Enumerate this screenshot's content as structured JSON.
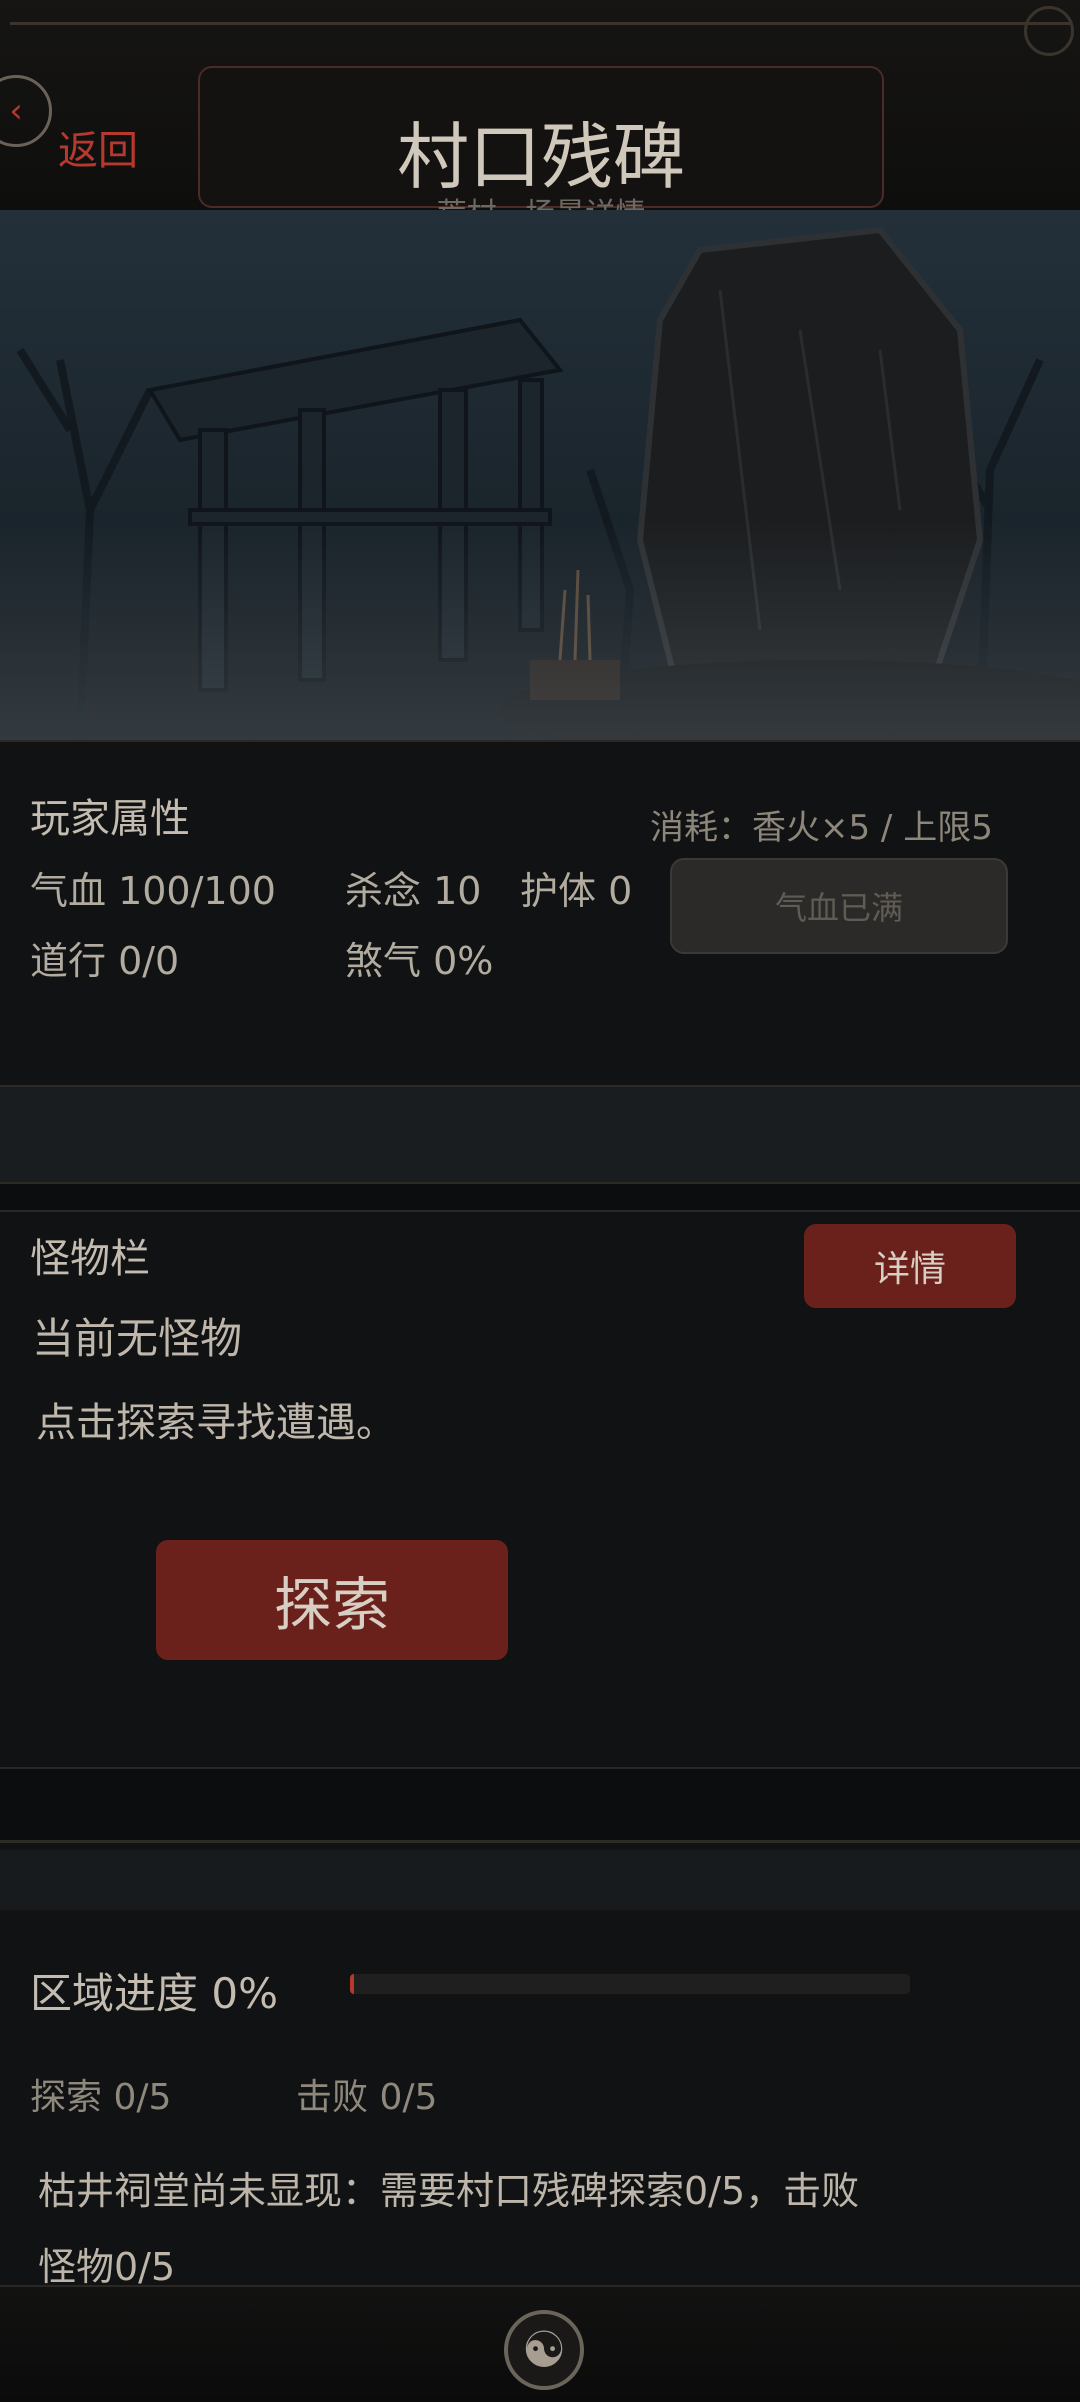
{
  "header": {
    "back_icon": "chevron-left-icon",
    "back_label": "返回",
    "title": "村口残碑",
    "subtitle": "荒村 · 场景详情"
  },
  "scene": {
    "image": "ruined village gate and broken stone stele in misty forest"
  },
  "player": {
    "heading": "玩家属性",
    "cost_text": "消耗：香火×5 / 上限5",
    "hp": "气血 100/100",
    "killing_intent": "杀念 10",
    "defense": "护体 0",
    "dao": "道行 0/0",
    "evil_qi": "煞气 0%",
    "heal_button": "气血已满"
  },
  "monster": {
    "heading": "怪物栏",
    "detail_button": "详情",
    "empty_text": "当前无怪物",
    "hint_text": "点击探索寻找遭遇。",
    "explore_button": "探索"
  },
  "region": {
    "progress_label": "区域进度 0%",
    "progress_value": 0,
    "explore_count": "探索 0/5",
    "defeat_count": "击败 0/5",
    "unlock_line1": "枯井祠堂尚未显现：需要村口残碑探索0/5，击败",
    "unlock_line2": "怪物0/5"
  },
  "colors": {
    "accent_red": "#b5392e",
    "button_red": "#6b211b"
  },
  "footer": {
    "emblem_icon": "yin-yang-icon"
  }
}
